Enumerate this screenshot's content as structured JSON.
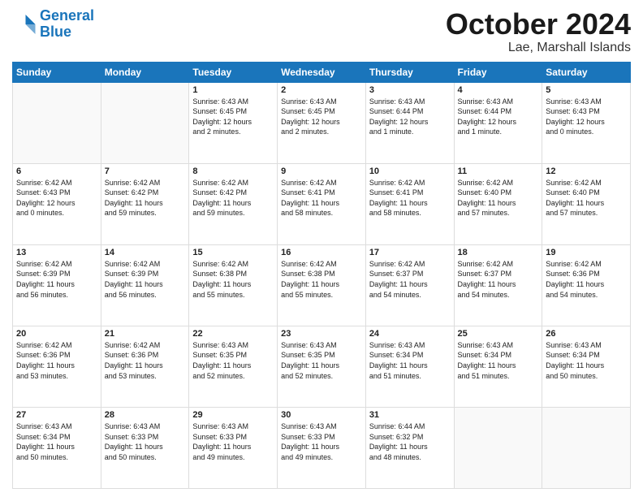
{
  "header": {
    "logo_line1": "General",
    "logo_line2": "Blue",
    "month": "October 2024",
    "location": "Lae, Marshall Islands"
  },
  "weekdays": [
    "Sunday",
    "Monday",
    "Tuesday",
    "Wednesday",
    "Thursday",
    "Friday",
    "Saturday"
  ],
  "weeks": [
    [
      {
        "day": "",
        "info": ""
      },
      {
        "day": "",
        "info": ""
      },
      {
        "day": "1",
        "info": "Sunrise: 6:43 AM\nSunset: 6:45 PM\nDaylight: 12 hours\nand 2 minutes."
      },
      {
        "day": "2",
        "info": "Sunrise: 6:43 AM\nSunset: 6:45 PM\nDaylight: 12 hours\nand 2 minutes."
      },
      {
        "day": "3",
        "info": "Sunrise: 6:43 AM\nSunset: 6:44 PM\nDaylight: 12 hours\nand 1 minute."
      },
      {
        "day": "4",
        "info": "Sunrise: 6:43 AM\nSunset: 6:44 PM\nDaylight: 12 hours\nand 1 minute."
      },
      {
        "day": "5",
        "info": "Sunrise: 6:43 AM\nSunset: 6:43 PM\nDaylight: 12 hours\nand 0 minutes."
      }
    ],
    [
      {
        "day": "6",
        "info": "Sunrise: 6:42 AM\nSunset: 6:43 PM\nDaylight: 12 hours\nand 0 minutes."
      },
      {
        "day": "7",
        "info": "Sunrise: 6:42 AM\nSunset: 6:42 PM\nDaylight: 11 hours\nand 59 minutes."
      },
      {
        "day": "8",
        "info": "Sunrise: 6:42 AM\nSunset: 6:42 PM\nDaylight: 11 hours\nand 59 minutes."
      },
      {
        "day": "9",
        "info": "Sunrise: 6:42 AM\nSunset: 6:41 PM\nDaylight: 11 hours\nand 58 minutes."
      },
      {
        "day": "10",
        "info": "Sunrise: 6:42 AM\nSunset: 6:41 PM\nDaylight: 11 hours\nand 58 minutes."
      },
      {
        "day": "11",
        "info": "Sunrise: 6:42 AM\nSunset: 6:40 PM\nDaylight: 11 hours\nand 57 minutes."
      },
      {
        "day": "12",
        "info": "Sunrise: 6:42 AM\nSunset: 6:40 PM\nDaylight: 11 hours\nand 57 minutes."
      }
    ],
    [
      {
        "day": "13",
        "info": "Sunrise: 6:42 AM\nSunset: 6:39 PM\nDaylight: 11 hours\nand 56 minutes."
      },
      {
        "day": "14",
        "info": "Sunrise: 6:42 AM\nSunset: 6:39 PM\nDaylight: 11 hours\nand 56 minutes."
      },
      {
        "day": "15",
        "info": "Sunrise: 6:42 AM\nSunset: 6:38 PM\nDaylight: 11 hours\nand 55 minutes."
      },
      {
        "day": "16",
        "info": "Sunrise: 6:42 AM\nSunset: 6:38 PM\nDaylight: 11 hours\nand 55 minutes."
      },
      {
        "day": "17",
        "info": "Sunrise: 6:42 AM\nSunset: 6:37 PM\nDaylight: 11 hours\nand 54 minutes."
      },
      {
        "day": "18",
        "info": "Sunrise: 6:42 AM\nSunset: 6:37 PM\nDaylight: 11 hours\nand 54 minutes."
      },
      {
        "day": "19",
        "info": "Sunrise: 6:42 AM\nSunset: 6:36 PM\nDaylight: 11 hours\nand 54 minutes."
      }
    ],
    [
      {
        "day": "20",
        "info": "Sunrise: 6:42 AM\nSunset: 6:36 PM\nDaylight: 11 hours\nand 53 minutes."
      },
      {
        "day": "21",
        "info": "Sunrise: 6:42 AM\nSunset: 6:36 PM\nDaylight: 11 hours\nand 53 minutes."
      },
      {
        "day": "22",
        "info": "Sunrise: 6:43 AM\nSunset: 6:35 PM\nDaylight: 11 hours\nand 52 minutes."
      },
      {
        "day": "23",
        "info": "Sunrise: 6:43 AM\nSunset: 6:35 PM\nDaylight: 11 hours\nand 52 minutes."
      },
      {
        "day": "24",
        "info": "Sunrise: 6:43 AM\nSunset: 6:34 PM\nDaylight: 11 hours\nand 51 minutes."
      },
      {
        "day": "25",
        "info": "Sunrise: 6:43 AM\nSunset: 6:34 PM\nDaylight: 11 hours\nand 51 minutes."
      },
      {
        "day": "26",
        "info": "Sunrise: 6:43 AM\nSunset: 6:34 PM\nDaylight: 11 hours\nand 50 minutes."
      }
    ],
    [
      {
        "day": "27",
        "info": "Sunrise: 6:43 AM\nSunset: 6:34 PM\nDaylight: 11 hours\nand 50 minutes."
      },
      {
        "day": "28",
        "info": "Sunrise: 6:43 AM\nSunset: 6:33 PM\nDaylight: 11 hours\nand 50 minutes."
      },
      {
        "day": "29",
        "info": "Sunrise: 6:43 AM\nSunset: 6:33 PM\nDaylight: 11 hours\nand 49 minutes."
      },
      {
        "day": "30",
        "info": "Sunrise: 6:43 AM\nSunset: 6:33 PM\nDaylight: 11 hours\nand 49 minutes."
      },
      {
        "day": "31",
        "info": "Sunrise: 6:44 AM\nSunset: 6:32 PM\nDaylight: 11 hours\nand 48 minutes."
      },
      {
        "day": "",
        "info": ""
      },
      {
        "day": "",
        "info": ""
      }
    ]
  ]
}
